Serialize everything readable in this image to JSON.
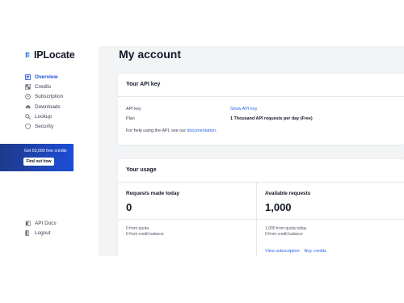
{
  "brand": {
    "name": "IPLocate"
  },
  "sidebar": {
    "items": [
      {
        "label": "Overview",
        "icon": "overview-icon"
      },
      {
        "label": "Credits",
        "icon": "credits-icon"
      },
      {
        "label": "Subscription",
        "icon": "subscription-icon"
      },
      {
        "label": "Downloads",
        "icon": "download-cloud-icon"
      },
      {
        "label": "Lookup",
        "icon": "search-icon"
      },
      {
        "label": "Security",
        "icon": "shield-icon"
      }
    ],
    "bottom_items": [
      {
        "label": "API Docs",
        "icon": "docs-icon"
      },
      {
        "label": "Logout",
        "icon": "logout-icon"
      }
    ]
  },
  "promo": {
    "title": "Get 50,000 free credits",
    "button": "Find out how"
  },
  "main": {
    "title": "My account",
    "api_card": {
      "title": "Your API key",
      "api_key_label": "API key",
      "api_key_value": "Show API key",
      "plan_label": "Plan",
      "plan_value": "1 Thousand API requests per day (Free)",
      "help_text": "For help using the API, see our",
      "help_link": "documentation",
      "help_end": "."
    },
    "usage_card": {
      "title": "Your usage",
      "left": {
        "heading": "Requests made today",
        "value": "0",
        "sub1": "0 from quota",
        "sub2": "0 from credit balance"
      },
      "right": {
        "heading": "Available requests",
        "value": "1,000",
        "sub1": "1,000 from quota today",
        "sub2": "0 from credit balance",
        "link1": "View subscription",
        "link2": "Buy credits"
      }
    }
  },
  "colors": {
    "accent": "#2563eb",
    "promo_bg": "#1d4ed8",
    "main_bg": "#f3f4f6"
  }
}
